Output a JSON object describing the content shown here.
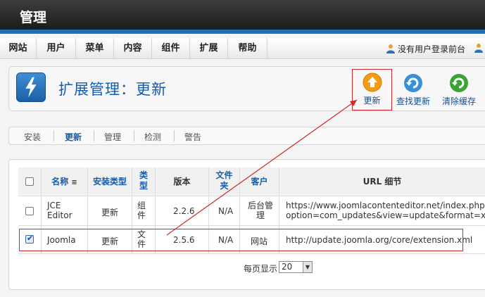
{
  "header": {
    "title": "管理"
  },
  "menu": {
    "items": [
      "网站",
      "用户",
      "菜单",
      "内容",
      "组件",
      "扩展",
      "帮助"
    ],
    "status": "没有用户登录前台"
  },
  "toolbar": {
    "title": "扩展管理：更新",
    "buttons": {
      "update": "更新",
      "find": "查找更新",
      "purge": "清除缓存"
    }
  },
  "tabs": {
    "items": [
      "安装",
      "更新",
      "管理",
      "检测",
      "警告"
    ],
    "active": "更新"
  },
  "table": {
    "headers": {
      "name": "名称",
      "install_type": "安装类型",
      "type_line1": "类",
      "type_line2": "型",
      "version": "版本",
      "folder_line1": "文件",
      "folder_line2": "夹",
      "client": "客户",
      "url": "URL 细节"
    },
    "rows": [
      {
        "name_line1": "JCE",
        "name_line2": "Editor",
        "install_type": "更新",
        "type_line1": "组",
        "type_line2": "件",
        "version": "2.2.6",
        "folder": "N/A",
        "client_line1": "后台管",
        "client_line2": "理",
        "url_line1": "https://www.joomlacontenteditor.net/index.php?",
        "url_line2": "option=com_updates&view=update&format=xml&id=",
        "checked": false
      },
      {
        "name": "Joomla",
        "install_type": "更新",
        "type_line1": "文",
        "type_line2": "件",
        "version": "2.5.6",
        "folder": "N/A",
        "client": "网站",
        "url": "http://update.joomla.org/core/extension.xml",
        "checked": true
      }
    ]
  },
  "pager": {
    "label": "每页显示",
    "value": "20"
  },
  "colors": {
    "accent": "#135cae",
    "header_bar": "#1d6fb6",
    "highlight": "#cc2a2a",
    "update_orange": "#f29b13",
    "green": "#3aa333"
  }
}
